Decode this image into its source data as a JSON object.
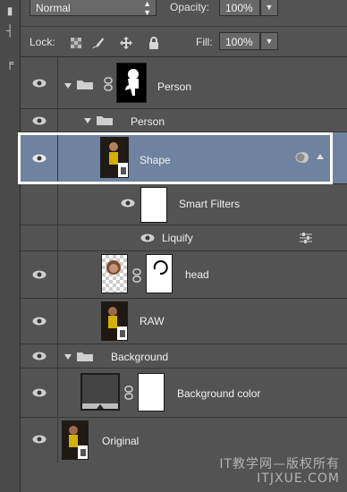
{
  "options": {
    "blend_mode": "Normal",
    "opacity_label": "Opacity:",
    "opacity_value": "100%",
    "lock_label": "Lock:",
    "fill_label": "Fill:",
    "fill_value": "100%"
  },
  "layers": [
    {
      "name": "Person",
      "type": "group-with-mask"
    },
    {
      "name": "Person",
      "type": "group"
    },
    {
      "name": "Shape",
      "type": "smart-object",
      "selected": true
    },
    {
      "name": "Smart Filters",
      "type": "smart-filters"
    },
    {
      "name": "Liquify",
      "type": "filter"
    },
    {
      "name": "head",
      "type": "layer-with-mask"
    },
    {
      "name": "RAW",
      "type": "smart-object"
    },
    {
      "name": "Background",
      "type": "group"
    },
    {
      "name": "Background color",
      "type": "fill-with-mask"
    },
    {
      "name": "Original",
      "type": "smart-object"
    }
  ],
  "watermark": {
    "line1": "IT教学网—版权所有",
    "line2": "ITJXUE.COM"
  },
  "colors": {
    "panel_bg": "#535353",
    "selected_row": "#6f82a0",
    "highlight_border": "#ffffff"
  }
}
